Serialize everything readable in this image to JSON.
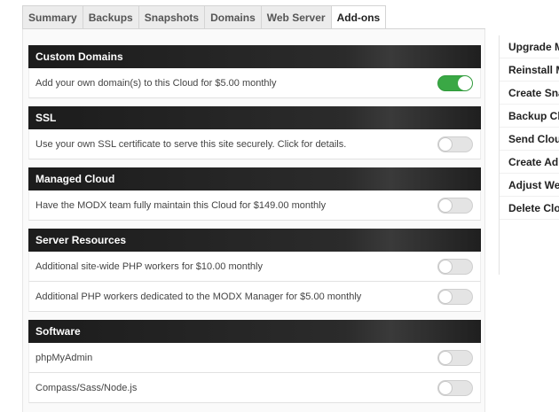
{
  "tabs": [
    {
      "label": "Summary",
      "active": false
    },
    {
      "label": "Backups",
      "active": false
    },
    {
      "label": "Snapshots",
      "active": false
    },
    {
      "label": "Domains",
      "active": false
    },
    {
      "label": "Web Server",
      "active": false
    },
    {
      "label": "Add-ons",
      "active": true
    }
  ],
  "sections": [
    {
      "title": "Custom Domains",
      "rows": [
        {
          "label": "Add your own domain(s) to this Cloud for $5.00 monthly",
          "enabled": true
        }
      ]
    },
    {
      "title": "SSL",
      "rows": [
        {
          "label": "Use your own SSL certificate to serve this site securely. Click for details.",
          "enabled": false
        }
      ]
    },
    {
      "title": "Managed Cloud",
      "rows": [
        {
          "label": "Have the MODX team fully maintain this Cloud for $149.00 monthly",
          "enabled": false
        }
      ]
    },
    {
      "title": "Server Resources",
      "rows": [
        {
          "label": "Additional site-wide PHP workers for $10.00 monthly",
          "enabled": false
        },
        {
          "label": "Additional PHP workers dedicated to the MODX Manager for $5.00 monthly",
          "enabled": false
        }
      ]
    },
    {
      "title": "Software",
      "rows": [
        {
          "label": "phpMyAdmin",
          "enabled": false
        },
        {
          "label": "Compass/Sass/Node.js",
          "enabled": false
        }
      ]
    }
  ],
  "sidebar": {
    "items": [
      {
        "label": "Upgrade MODX"
      },
      {
        "label": "Reinstall MODX"
      },
      {
        "label": "Create Snapshot"
      },
      {
        "label": "Backup Cloud"
      },
      {
        "label": "Send Cloud"
      },
      {
        "label": "Create Admin"
      },
      {
        "label": "Adjust Web"
      },
      {
        "label": "Delete Cloud"
      }
    ]
  },
  "colors": {
    "toggle_on": "#3aa845",
    "header_dark": "#1c1c1c"
  }
}
